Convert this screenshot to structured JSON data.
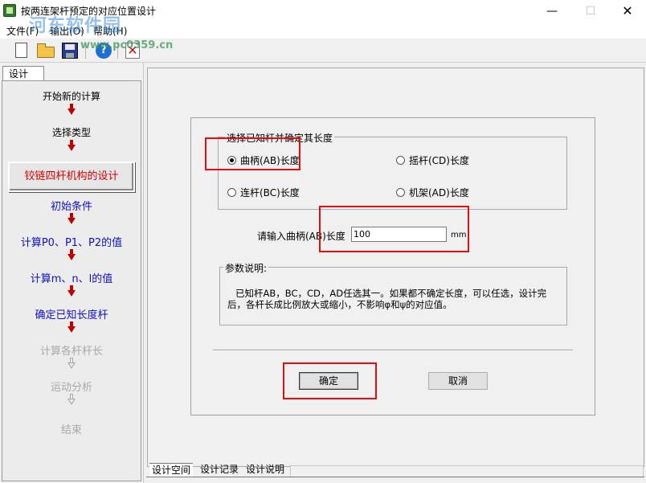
{
  "window": {
    "title": "按两连架杆预定的对应位置设计",
    "minimize": "—",
    "maximize": "☐",
    "close": "✕"
  },
  "watermark": {
    "text": "河东软件园",
    "url": "www.pc0359.cn"
  },
  "menu": {
    "file": "文件(F)",
    "output": "输出(O)",
    "help": "帮助(H)"
  },
  "toolbar": {
    "help_glyph": "?",
    "exit_glyph": "✕"
  },
  "left_panel": {
    "tab_label": "设计",
    "steps": {
      "new_calc": "开始新的计算",
      "select_type": "选择类型",
      "current": "铰链四杆机构的设计",
      "initial": "初始条件",
      "calc_p": "计算P0、P1、P2的值",
      "calc_mnl": "计算m、n、l的值",
      "known_rod": "确定已知长度杆",
      "calc_rods": "计算各杆杆长",
      "motion": "运动分析",
      "end": "结束"
    }
  },
  "dialog": {
    "group_select_title": "选择已知杆并确定其长度",
    "options": {
      "crank": "曲柄(AB)长度",
      "rocker": "摇杆(CD)长度",
      "coupler": "连杆(BC)长度",
      "frame": "机架(AD)长度"
    },
    "selected_option": "crank",
    "input_label": "请输入曲柄(AB)长度",
    "input_value": "100",
    "unit": "mm",
    "group_desc_title": "参数说明:",
    "desc_line1": "已知杆AB，BC，CD，AD任选其一。如果都不确定长度，可以任选，设计完",
    "desc_line2": "后，各杆长成比例放大或缩小，不影响φ和ψ的对应值。",
    "ok_label": "确定",
    "cancel_label": "取消"
  },
  "bottom_tabs": {
    "tab1": "设计空间",
    "tab2": "设计记录",
    "tab3": "设计说明"
  },
  "colors": {
    "highlight_box": "#e01010",
    "current_step_text": "#d00000",
    "link_step_text": "#1010c8",
    "disabled_step_text": "#a8a8a8",
    "arrow": "#c00000"
  }
}
